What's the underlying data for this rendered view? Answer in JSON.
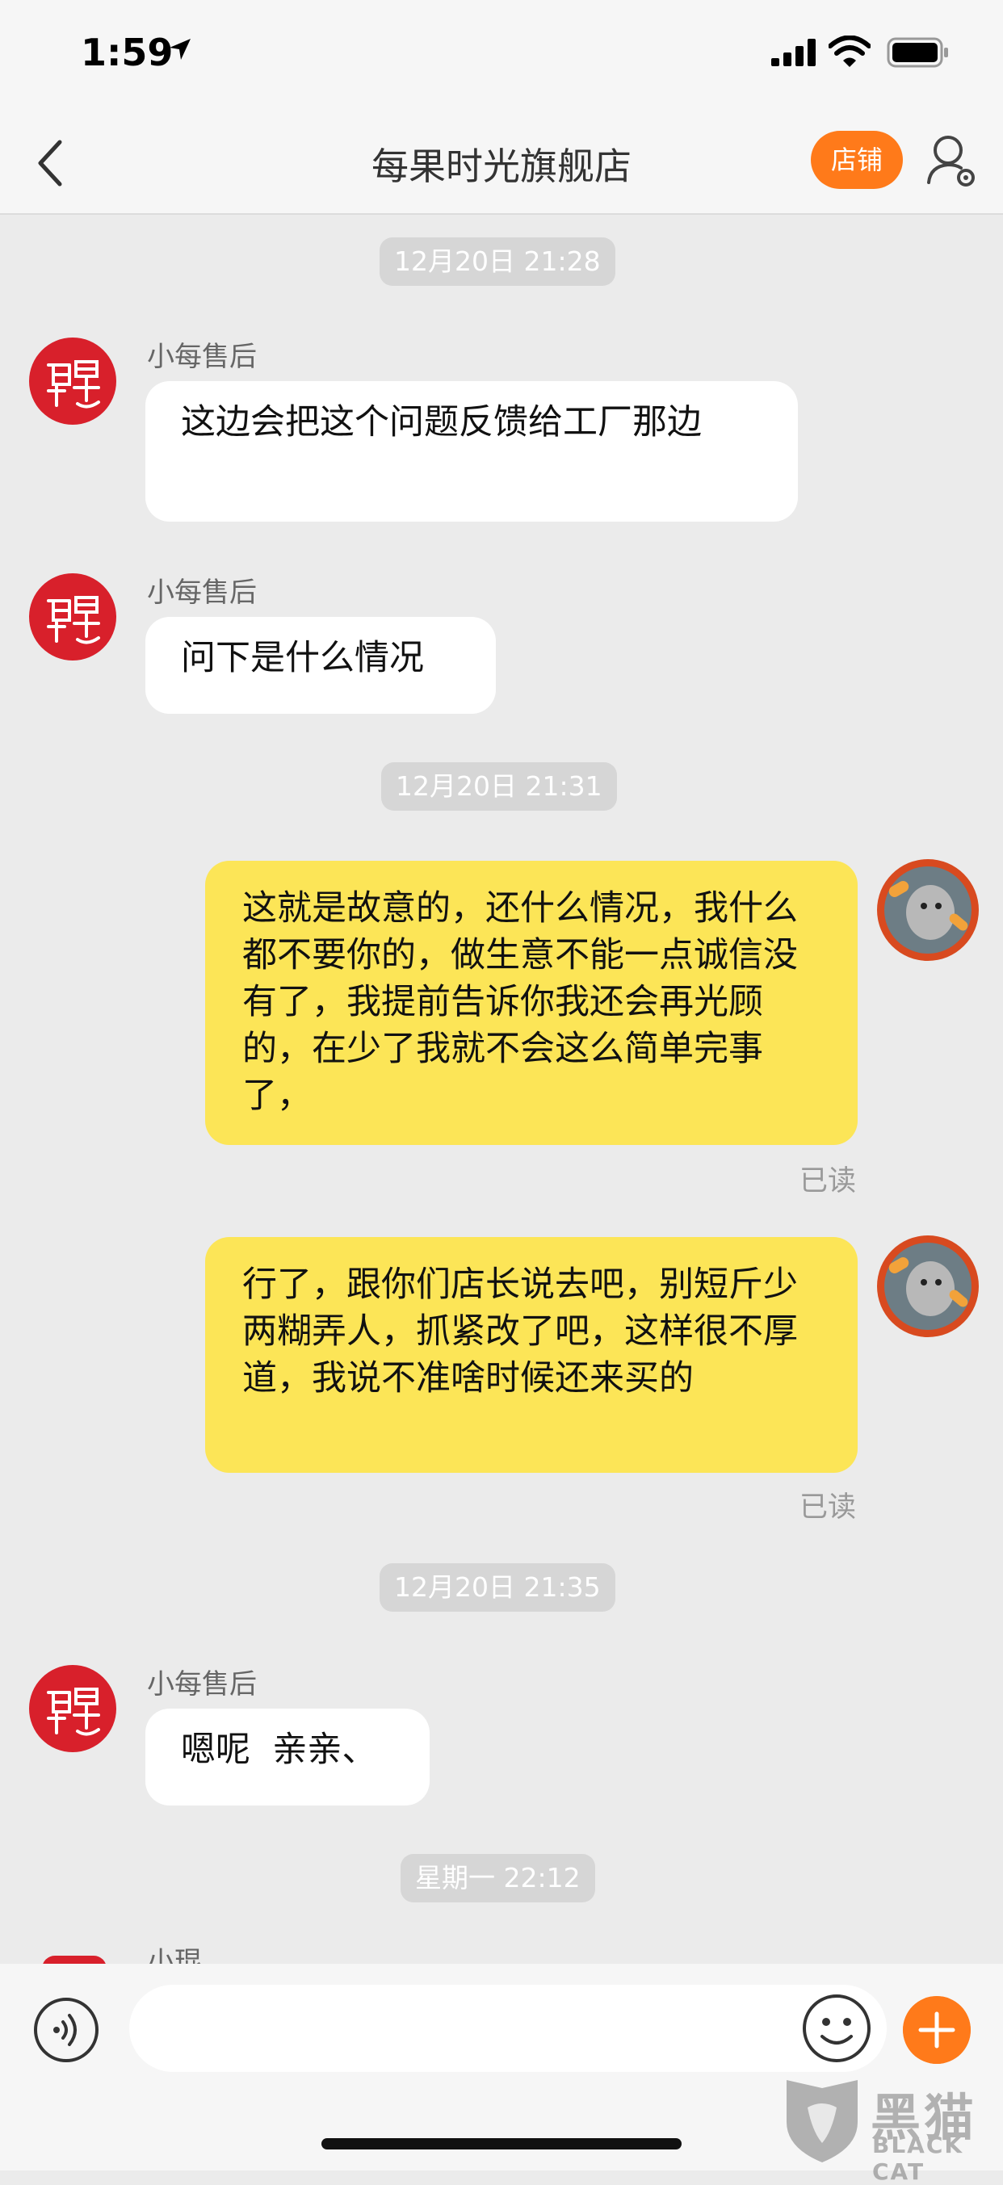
{
  "status_bar": {
    "time": "1:59"
  },
  "nav": {
    "title": "每果时光旗舰店",
    "store_button": "店铺"
  },
  "conversation": {
    "timestamps": [
      "12月20日 21:28",
      "12月20日 21:31",
      "12月20日 21:35",
      "星期一 22:12"
    ],
    "messages": [
      {
        "sender": "小每售后",
        "text": "这边会把这个问题反馈给工厂那边"
      },
      {
        "sender": "小每售后",
        "text": "问下是什么情况"
      },
      {
        "text": "这就是故意的，还什么情况，我什么都不要你的，做生意不能一点诚信没有了，我提前告诉你我还会再光顾的，在少了我就不会这么简单完事了，",
        "status": "已读"
      },
      {
        "text": "行了，跟你们店长说去吧，别短斤少两糊弄人，抓紧改了吧，这样很不厚道，我说不准啥时候还来买的",
        "status": "已读"
      },
      {
        "sender": "小每售后",
        "text": "嗯呢  亲亲、"
      }
    ],
    "partial_sender": "小琨"
  },
  "input_bar": {
    "placeholder": ""
  },
  "watermark": {
    "zh": "黑猫",
    "en": "BLACK CAT"
  },
  "colors": {
    "accent": "#ff7a1a",
    "outgoing_bubble": "#fce557",
    "incoming_bubble": "#ffffff",
    "background": "#ebebeb"
  },
  "icons": [
    "location-arrow-icon",
    "signal-icon",
    "wifi-icon",
    "battery-icon",
    "back-chevron-icon",
    "user-settings-icon",
    "voice-icon",
    "emoji-icon",
    "plus-icon"
  ]
}
